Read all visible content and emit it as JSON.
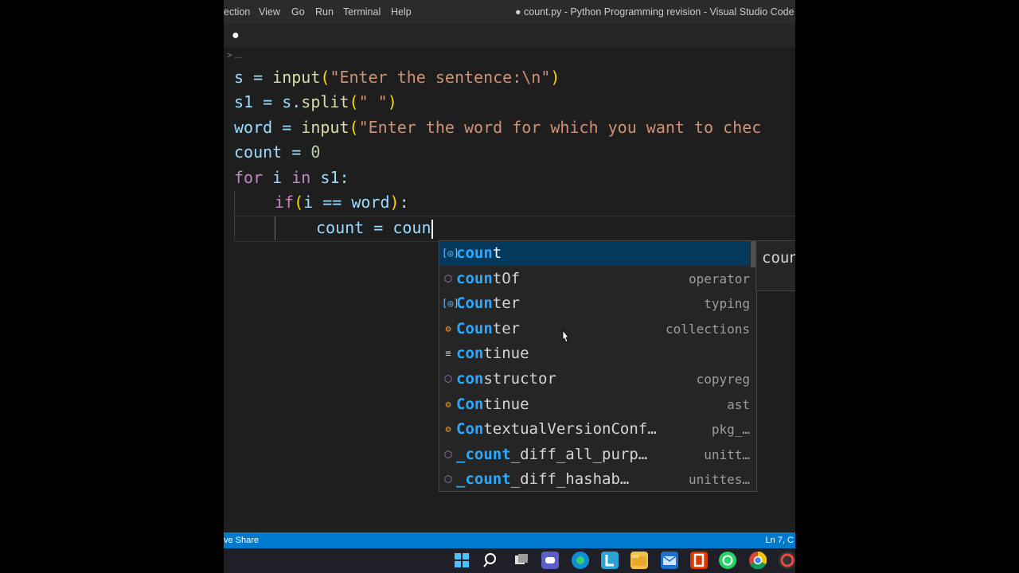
{
  "titlebar": {
    "menu": [
      "ection",
      "View",
      "Go",
      "Run",
      "Terminal",
      "Help"
    ],
    "title": "● count.py - Python Programming revision - Visual Studio Code"
  },
  "tab": {
    "modified_dot": "●"
  },
  "breadcrumb": "> ...",
  "code": {
    "l1": {
      "a": "s = ",
      "fn": "input",
      "p1": "(",
      "str": "\"Enter the sentence:\\n\"",
      "p2": ")"
    },
    "l2": {
      "a": "s1 = s.",
      "fn": "split",
      "p1": "(",
      "str": "\" \"",
      "p2": ")"
    },
    "l3": {
      "a": "word = ",
      "fn": "input",
      "p1": "(",
      "str": "\"Enter the word for which you want to chec"
    },
    "l4": {
      "a": "count = ",
      "num": "0"
    },
    "l5": {
      "kw": "for",
      "a": " i ",
      "kw2": "in",
      "b": " s1:"
    },
    "l6": {
      "kw": "if",
      "p1": "(",
      "a": "i == word",
      "p2": ")",
      "b": ":"
    },
    "l7": {
      "a": "count = coun"
    }
  },
  "suggestions": [
    {
      "icon": "variable-icon",
      "match": "coun",
      "rest": "t",
      "detail": ""
    },
    {
      "icon": "module-icon",
      "match": "coun",
      "rest": "tOf",
      "detail": "operator"
    },
    {
      "icon": "variable-icon",
      "match": "Coun",
      "rest": "ter",
      "detail": "typing"
    },
    {
      "icon": "class-icon",
      "match": "Coun",
      "rest": "ter",
      "detail": "collections"
    },
    {
      "icon": "keyword-icon",
      "match": "con",
      "rest": "tinue",
      "detail": ""
    },
    {
      "icon": "module-icon",
      "match": "con",
      "rest": "structor",
      "detail": "copyreg"
    },
    {
      "icon": "class-icon",
      "match": "Con",
      "rest": "tinue",
      "detail": "ast"
    },
    {
      "icon": "class-icon",
      "match": "Con",
      "rest": "textualVersionConf…",
      "detail": "pkg_…"
    },
    {
      "icon": "module-icon",
      "match": "_count",
      "rest": "_diff_all_purp…",
      "detail": "unitt…"
    },
    {
      "icon": "module-icon",
      "match": "_count",
      "rest": "_diff_hashab…",
      "detail": "unittes…"
    }
  ],
  "detail_pane": "coun",
  "statusbar": {
    "left": "ve Share",
    "right": "Ln 7, C"
  },
  "colors": {
    "statusbar": "#007acc",
    "selection": "#04395e",
    "match": "#2aaaff"
  }
}
